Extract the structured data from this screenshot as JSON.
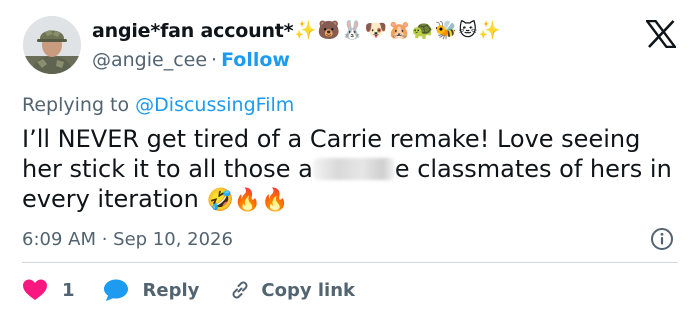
{
  "author": {
    "display_name": "angie*fan account*",
    "name_emojis": [
      "✨",
      "🐻",
      "🐰",
      "🐶",
      "🐹",
      "🐢",
      "🐝",
      "🐱",
      "✨"
    ],
    "handle": "@angie_cee",
    "separator": "·",
    "follow_label": "Follow"
  },
  "reply_context": {
    "prefix": "Replying to",
    "mention": "@DiscussingFilm"
  },
  "tweet": {
    "text_before": "I’ll NEVER get tired of a Carrie remake! Love seeing her stick it to all those a",
    "text_after": "e classmates of hers in every iteration",
    "emojis": "🤣🔥🔥"
  },
  "meta": {
    "timestamp": "6:09 AM · Sep 10, 2026"
  },
  "actions": {
    "like_count": "1",
    "reply_label": "Reply",
    "copy_label": "Copy link"
  },
  "colors": {
    "accent": "#1d9bf0",
    "like": "#f91880",
    "muted": "#536471",
    "text": "#0f1419"
  }
}
